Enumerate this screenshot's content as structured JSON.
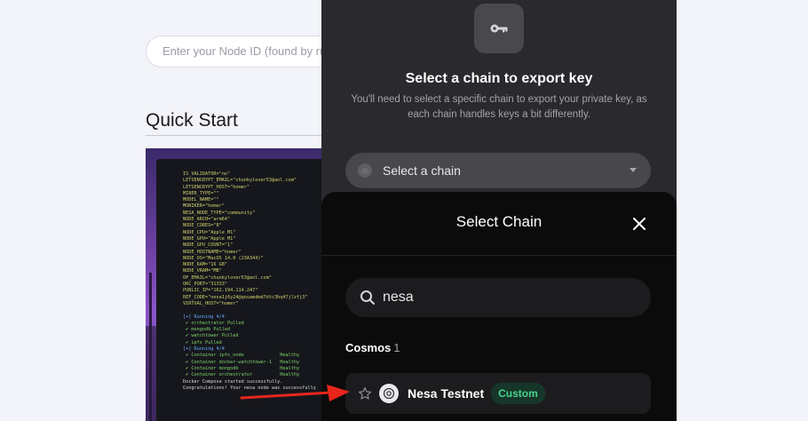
{
  "background": {
    "node_input_placeholder": "Enter your Node ID (found by running",
    "quick_start_title": "Quick Start",
    "terminal_lines": [
      "IS_VALIDATOR=\"no\"",
      "LETSENCRYPT_EMAIL=\"chunkylover53@aol.com\"",
      "LETSENCRYPT_HOST=\"homer\"",
      "MINER_TYPE=\"\"",
      "MODEL_NAME=\"\"",
      "MONIKER=\"homer\"",
      "NESA_NODE_TYPE=\"community\"",
      "NODE_ARCH=\"arm64\"",
      "NODE_CORES=\"8\"",
      "NODE_CPU=\"Apple M1\"",
      "NODE_GPU=\"Apple M1\"",
      "NODE_GPU_COUNT=\"1\"",
      "NODE_HOSTNAME=\"homer\"",
      "NODE_OS=\"MacOS 14.0 (23A344)\"",
      "NODE_RAM=\"16 GB\"",
      "NODE_VRAM=\"MB\"",
      "OP_EMAIL=\"chunkylover53@aol.com\"",
      "ORC_PORT=\"31333\"",
      "PUBLIC_IP=\"162.194.114.247\"",
      "REF_CODE=\"nesa1j6y24@qnuamdmd7dtc3hq47jlzfj3\"",
      "VIRTUAL_HOST=\"homer\"",
      "",
      "[+] Running 4/4",
      " ✔ orchestrator Pulled",
      " ✔ mongodb Pulled",
      " ✔ watchtower Pulled",
      " ✔ ipfs Pulled",
      "[+] Running 4/4",
      " ✔ Container ipfs_node             Healthy",
      " ✔ Container docker-watchtower-1   Healthy",
      " ✔ Container mongodb               Healthy",
      " ✔ Container orchestrator          Healthy",
      "Docker Compose started successfully.",
      "Congratulations! Your nesa node was successfully"
    ]
  },
  "export": {
    "title": "Select a chain to export key",
    "description": "You'll need to select a specific chain to export your private key, as each chain handles keys a bit differently.",
    "select_placeholder": "Select a chain"
  },
  "sheet": {
    "title": "Select Chain",
    "search_value": "nesa",
    "category_name": "Cosmos",
    "category_count": "1",
    "chains": [
      {
        "name": "Nesa Testnet",
        "badge": "Custom"
      }
    ]
  },
  "colors": {
    "panel_bg": "#2a2a2e",
    "sheet_bg": "#0b0b0c",
    "badge_text": "#4ad38a",
    "badge_bg": "#16362a",
    "arrow": "#e8261c"
  }
}
